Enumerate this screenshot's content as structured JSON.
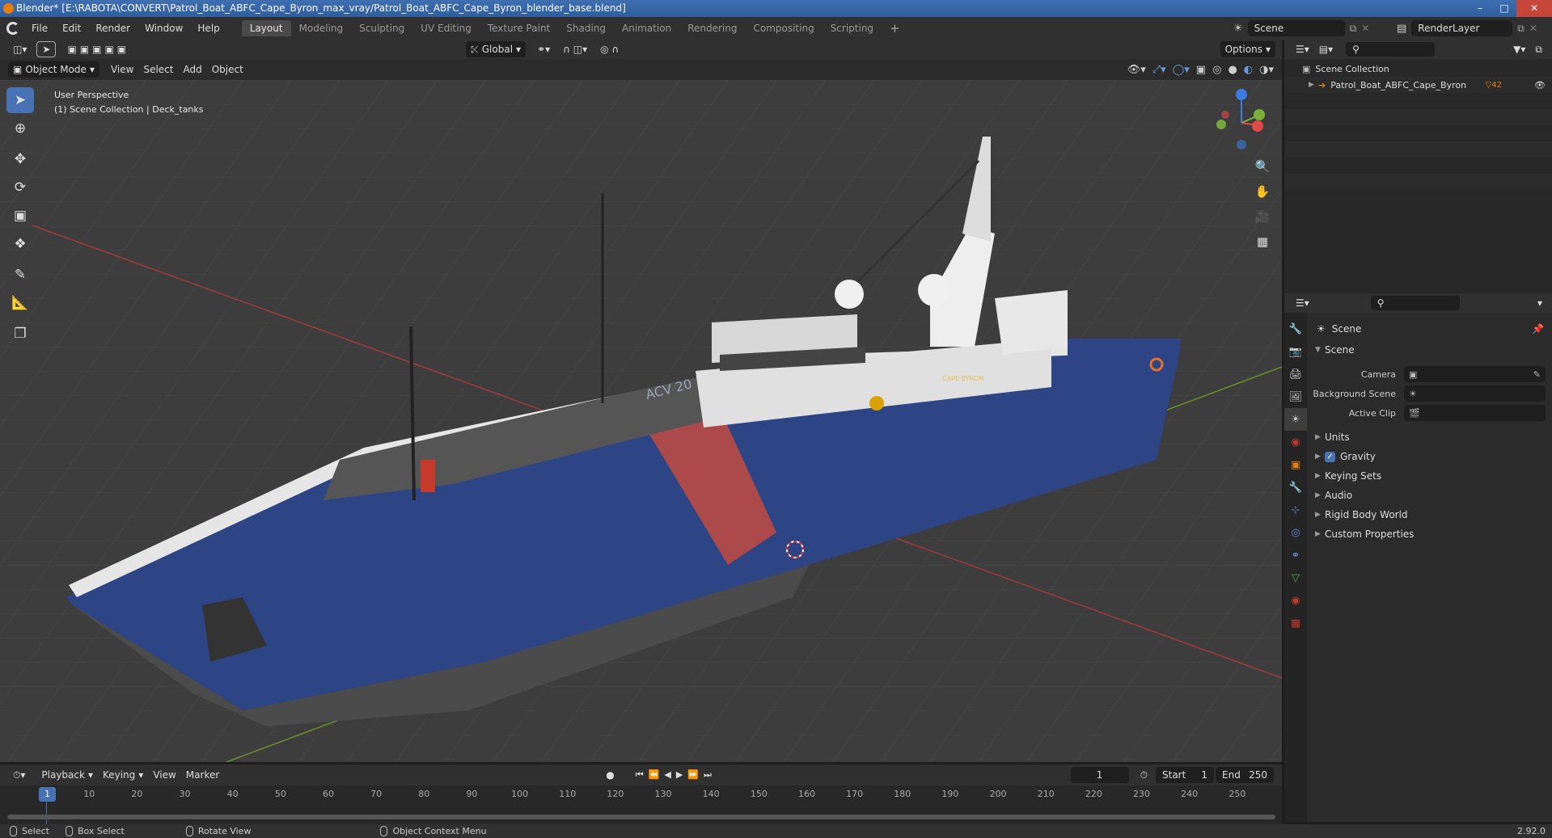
{
  "window": {
    "title": "Blender* [E:\\RABOTA\\CONVERT\\Patrol_Boat_ABFC_Cape_Byron_max_vray/Patrol_Boat_ABFC_Cape_Byron_blender_base.blend]"
  },
  "menus": [
    "File",
    "Edit",
    "Render",
    "Window",
    "Help"
  ],
  "workspaces": [
    "Layout",
    "Modeling",
    "Sculpting",
    "UV Editing",
    "Texture Paint",
    "Shading",
    "Animation",
    "Rendering",
    "Compositing",
    "Scripting"
  ],
  "active_workspace": "Layout",
  "scene_field": "Scene",
  "renderlayer_field": "RenderLayer",
  "toolheader": {
    "orientation": "Global",
    "options": "Options"
  },
  "viewheader": {
    "mode": "Object Mode",
    "view": "View",
    "select": "Select",
    "add": "Add",
    "object": "Object"
  },
  "viewport": {
    "perspective": "User Perspective",
    "collection": "(1) Scene Collection | Deck_tanks",
    "boat_name": "CAPE BYRON",
    "hull_number": "ACV 20"
  },
  "outliner": {
    "root": "Scene Collection",
    "object": "Patrol_Boat_ABFC_Cape_Byron",
    "badge": "42"
  },
  "properties": {
    "header": "Scene",
    "panel": "Scene",
    "fields": [
      {
        "label": "Camera",
        "value": ""
      },
      {
        "label": "Background Scene",
        "value": ""
      },
      {
        "label": "Active Clip",
        "value": ""
      }
    ],
    "subpanels": [
      "Units",
      "Gravity",
      "Keying Sets",
      "Audio",
      "Rigid Body World",
      "Custom Properties"
    ],
    "gravity_checked": true
  },
  "timeline": {
    "menus": [
      "Playback",
      "Keying",
      "View",
      "Marker"
    ],
    "current_frame": "1",
    "start_label": "Start",
    "start": "1",
    "end_label": "End",
    "end": "250",
    "ticks": [
      "1",
      "10",
      "20",
      "30",
      "40",
      "50",
      "60",
      "70",
      "80",
      "90",
      "100",
      "110",
      "120",
      "130",
      "140",
      "150",
      "160",
      "170",
      "180",
      "190",
      "200",
      "210",
      "220",
      "230",
      "240",
      "250"
    ]
  },
  "statusbar": {
    "select": "Select",
    "box_select": "Box Select",
    "rotate": "Rotate View",
    "context": "Object Context Menu",
    "version": "2.92.0"
  },
  "colors": {
    "accent": "#4772b3",
    "hull_blue": "#2e4585",
    "stripe_red": "#c24a3f",
    "orange": "#e87d0d"
  }
}
